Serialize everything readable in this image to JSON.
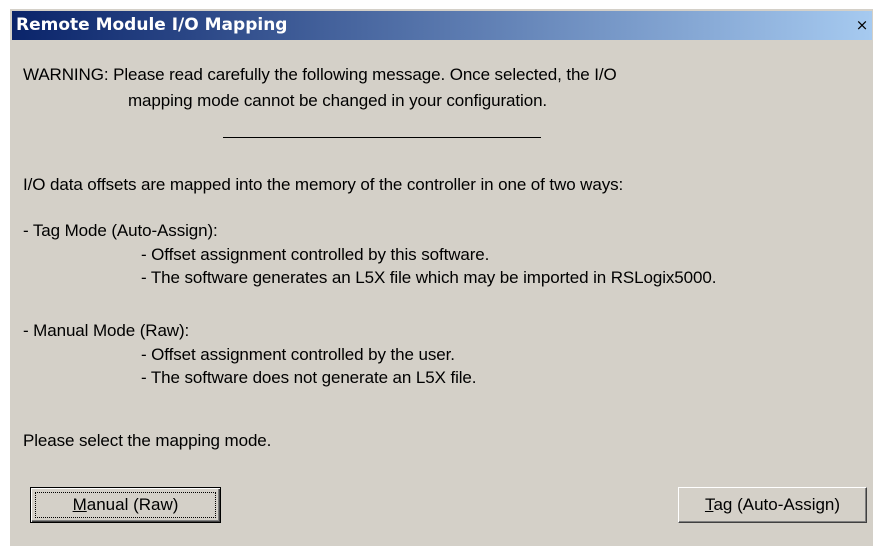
{
  "window": {
    "title": "Remote Module I/O Mapping",
    "close_glyph": "×"
  },
  "message": {
    "warning_line1": "WARNING: Please read carefully the following message. Once selected, the I/O",
    "warning_line2": "mapping mode cannot be changed in your configuration.",
    "intro": "I/O data offsets are mapped into the memory of the controller in one of two ways:",
    "tag_mode_heading": "- Tag Mode (Auto-Assign):",
    "tag_mode_point1": "- Offset assignment controlled by this software.",
    "tag_mode_point2": "- The software generates an L5X file which may be imported in RSLogix5000.",
    "manual_mode_heading": "- Manual Mode (Raw):",
    "manual_mode_point1": "- Offset assignment controlled by the user.",
    "manual_mode_point2": "- The software does not generate an L5X file.",
    "prompt": "Please select the mapping mode."
  },
  "buttons": {
    "manual": {
      "mnemonic": "M",
      "rest": "anual (Raw)"
    },
    "tag": {
      "mnemonic": "T",
      "rest": "ag (Auto-Assign)"
    }
  }
}
